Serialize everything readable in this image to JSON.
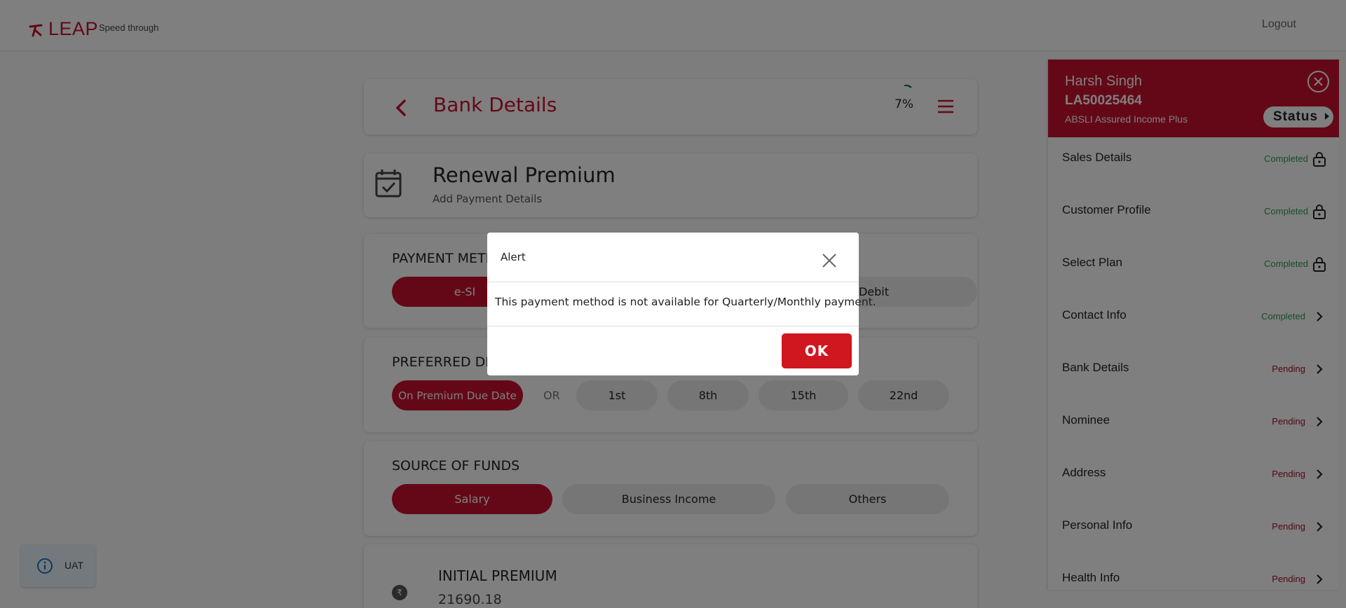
{
  "brand": {
    "logo_text": "LEAP",
    "tagline": "Speed through",
    "accent": "#c8102e"
  },
  "topbar": {
    "logout_label": "Logout"
  },
  "header": {
    "title": "Bank Details",
    "progress": "7%"
  },
  "renewal": {
    "title": "Renewal Premium",
    "subtitle": "Add Payment Details"
  },
  "payment_method": {
    "label": "PAYMENT METHOD",
    "options": [
      "e-SI",
      "Debit"
    ],
    "selected": "e-SI"
  },
  "draw_date": {
    "label": "PREFERRED DRAW DATE",
    "on_due_label": "On Premium Due Date",
    "or_label": "OR",
    "dates": [
      "1st",
      "8th",
      "15th",
      "22nd"
    ]
  },
  "source_of_funds": {
    "label": "SOURCE OF FUNDS",
    "options": [
      "Salary",
      "Business Income",
      "Others"
    ],
    "selected": "Salary"
  },
  "initial_premium": {
    "label": "INITIAL PREMIUM",
    "value": "21690.18",
    "icon": "rupee-icon"
  },
  "side_panel": {
    "name": "Harsh Singh",
    "application_id": "LA50025464",
    "plan": "ABSLI Assured Income Plus",
    "status_label": "Status",
    "items": [
      {
        "label": "Sales Details",
        "status": "Completed",
        "icon": "lock-icon"
      },
      {
        "label": "Customer Profile",
        "status": "Completed",
        "icon": "lock-icon"
      },
      {
        "label": "Select Plan",
        "status": "Completed",
        "icon": "lock-icon"
      },
      {
        "label": "Contact Info",
        "status": "Completed",
        "icon": "chevron-right-icon"
      },
      {
        "label": "Bank Details",
        "status": "Pending",
        "icon": "chevron-right-icon"
      },
      {
        "label": "Nominee",
        "status": "Pending",
        "icon": "chevron-right-icon"
      },
      {
        "label": "Address",
        "status": "Pending",
        "icon": "chevron-right-icon"
      },
      {
        "label": "Personal Info",
        "status": "Pending",
        "icon": "chevron-right-icon"
      },
      {
        "label": "Health Info",
        "status": "Pending",
        "icon": "chevron-right-icon"
      }
    ]
  },
  "env_badge": {
    "label": "UAT"
  },
  "alert": {
    "title": "Alert",
    "message": "This payment method is not available for Quarterly/Monthly payment.",
    "ok_label": "OK"
  }
}
